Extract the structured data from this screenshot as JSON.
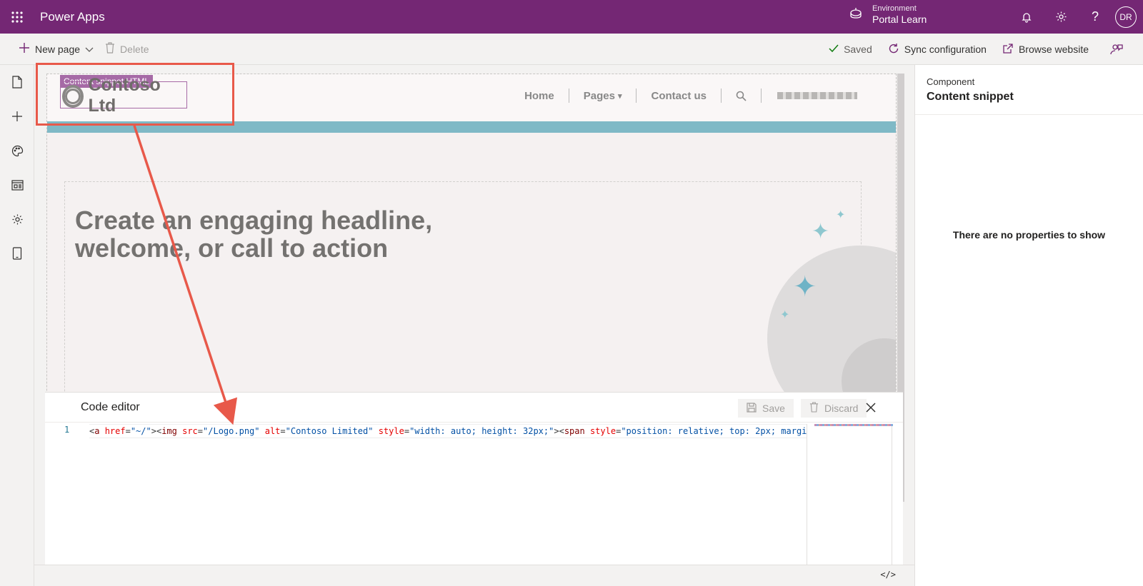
{
  "app": {
    "name": "Power Apps"
  },
  "environment": {
    "label": "Environment",
    "value": "Portal Learn"
  },
  "user": {
    "initials": "DR"
  },
  "commandbar": {
    "new_page": "New page",
    "delete": "Delete",
    "saved": "Saved",
    "sync": "Sync configuration",
    "browse": "Browse website"
  },
  "site": {
    "snippet_tag": "Content snippet HTML",
    "brand": "Contoso Ltd",
    "nav": [
      "Home",
      "Pages",
      "Contact us"
    ],
    "headline": "Create an engaging headline, welcome, or call to action"
  },
  "code_editor": {
    "title": "Code editor",
    "save": "Save",
    "discard": "Discard",
    "line_number": "1",
    "code": {
      "p1": "<",
      "tag1": "a",
      "a1": " href",
      "p2": "=",
      "v1": "\"~/\"",
      "p3": "><",
      "tag2": "img",
      "a2": " src",
      "p4": "=",
      "v2": "\"/Logo.png\"",
      "a3": " alt",
      "p5": "=",
      "v3": "\"Contoso Limited\"",
      "a4": " style",
      "p6": "=",
      "v4": "\"width: auto; height: 32px;\"",
      "p7": "><",
      "tag3": "span",
      "a5": " style",
      "p8": "=",
      "v5": "\"position: relative; top: 2px; margi"
    }
  },
  "right_panel": {
    "label": "Component",
    "title": "Content snippet",
    "empty": "There are no properties to show"
  },
  "bottom": {
    "code_toggle": "</>"
  },
  "colors": {
    "brand": "#742774",
    "annotation": "#e8594a",
    "accent_band": "#7fb9c6"
  }
}
